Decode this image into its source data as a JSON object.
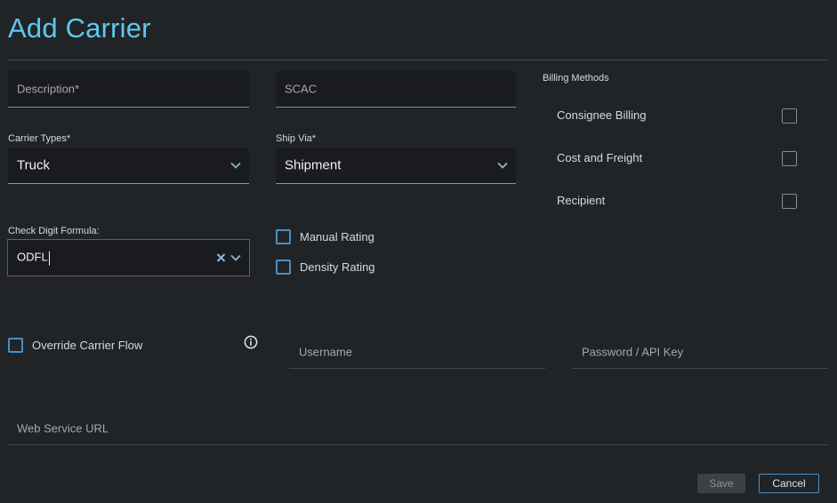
{
  "page": {
    "title": "Add Carrier"
  },
  "form": {
    "description": {
      "placeholder": "Description*"
    },
    "scac": {
      "placeholder": "SCAC"
    },
    "carrier_types": {
      "label": "Carrier Types*",
      "value": "Truck"
    },
    "ship_via": {
      "label": "Ship Via*",
      "value": "Shipment"
    },
    "check_digit": {
      "label": "Check Digit Formula:",
      "value": "ODFL"
    },
    "manual_rating": {
      "label": "Manual Rating",
      "checked": false
    },
    "density_rating": {
      "label": "Density Rating",
      "checked": false
    },
    "override_flow": {
      "label": "Override Carrier Flow",
      "checked": false
    },
    "username": {
      "placeholder": "Username"
    },
    "password": {
      "placeholder": "Password / API Key"
    },
    "web_service_url": {
      "placeholder": "Web Service URL"
    }
  },
  "billing": {
    "title": "Billing Methods",
    "items": [
      {
        "label": "Consignee Billing",
        "checked": false
      },
      {
        "label": "Cost and Freight",
        "checked": false
      },
      {
        "label": "Recipient",
        "checked": false
      }
    ]
  },
  "actions": {
    "save_label": "Save",
    "cancel_label": "Cancel"
  },
  "colors": {
    "accent": "#5ec8ee",
    "checkbox": "#4a8fc2",
    "background": "#212427"
  },
  "icons": {
    "dropdown": "chevron-down-icon",
    "clear": "close-icon",
    "info": "info-icon"
  }
}
